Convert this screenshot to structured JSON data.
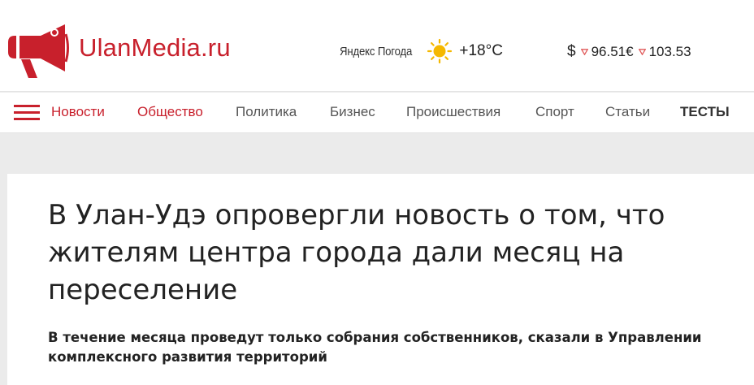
{
  "header": {
    "logo_text": "UlanMedia.ru",
    "brand_color": "#c8202c",
    "weather": {
      "provider_label": "Яндекс Погода",
      "icon": "sun-icon",
      "temperature": "+18°C"
    },
    "rates": {
      "currency_sign": "$",
      "usd": "96.51",
      "eur_sign": "€",
      "eur": "103.53",
      "trend_icon": "triangle-down-icon"
    }
  },
  "nav": {
    "menu_icon": "hamburger-icon",
    "items": [
      {
        "label": "Новости"
      },
      {
        "label": "Общество"
      },
      {
        "label": "Политика"
      },
      {
        "label": "Бизнес"
      },
      {
        "label": "Происшествия"
      },
      {
        "label": "Спорт"
      },
      {
        "label": "Статьи"
      },
      {
        "label": "ТЕСТЫ"
      }
    ]
  },
  "article": {
    "title": "В Улан-Удэ опровергли новость о том, что жителям центра города дали месяц на переселение",
    "lead": "В течение месяца проведут только собрания собственников, сказали в Управлении комплексного развития территорий"
  }
}
